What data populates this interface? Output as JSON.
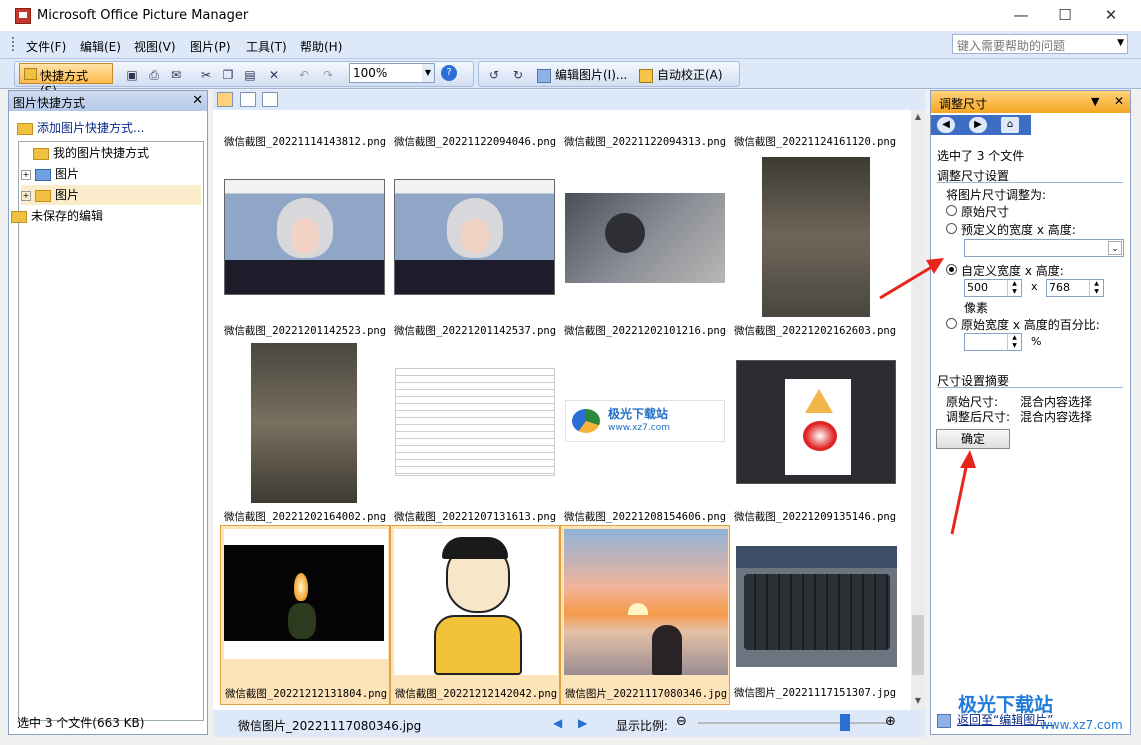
{
  "window": {
    "title": "Microsoft Office Picture Manager",
    "minimize": "—",
    "maximize": "☐",
    "close": "✕"
  },
  "menu": [
    "文件(F)",
    "编辑(E)",
    "视图(V)",
    "图片(P)",
    "工具(T)",
    "帮助(H)"
  ],
  "help_box": {
    "placeholder": "键入需要帮助的问题"
  },
  "toolbar": {
    "shortcut_label": "快捷方式(S)...",
    "zoom_value": "100%",
    "edit_pictures": "编辑图片(I)...",
    "auto_correct": "自动校正(A)"
  },
  "left_pane": {
    "title": "图片快捷方式",
    "add_shortcut": "添加图片快捷方式...",
    "tree": [
      {
        "label": "我的图片快捷方式",
        "level": 0
      },
      {
        "label": "图片",
        "level": 1
      },
      {
        "label": "图片",
        "level": 1,
        "selected": true
      },
      {
        "label": "未保存的编辑",
        "level": 0
      }
    ],
    "status": "选中 3 个文件(663 KB)"
  },
  "gallery": {
    "rows": [
      [
        "微信截图_20221114143812.png",
        "微信截图_20221122094046.png",
        "微信截图_20221122094313.png",
        "微信截图_20221124161120.png"
      ],
      [
        "微信截图_20221201142523.png",
        "微信截图_20221201142537.png",
        "微信截图_20221202101216.png",
        "微信截图_20221202162603.png"
      ],
      [
        "微信截图_20221202164002.png",
        "微信截图_20221207131613.png",
        "微信截图_20221208154606.png",
        "微信截图_20221209135146.png"
      ],
      [
        "微信截图_20221212131804.png",
        "微信截图_20221212142042.png",
        "微信图片_20221117080346.jpg",
        "微信图片_20221117151307.jpg"
      ]
    ],
    "selected": [
      "微信截图_20221212131804.png",
      "微信截图_20221212142042.png",
      "微信图片_20221117080346.jpg"
    ],
    "logo_text": "极光下载站",
    "logo_url": "www.xz7.com"
  },
  "status_bar": {
    "current_file": "微信图片_20221117080346.jpg",
    "zoom_label": "显示比例:"
  },
  "right_pane": {
    "title": "调整尺寸",
    "selected_count": "选中了 3 个文件",
    "section_settings": "调整尺寸设置",
    "resize_to": "将图片尺寸调整为:",
    "opt_original": "原始尺寸",
    "opt_predefined": "预定义的宽度 x 高度:",
    "opt_custom": "自定义宽度 x 高度:",
    "width_value": "500",
    "times": "x",
    "height_value": "768",
    "pixels": "像素",
    "opt_percent": "原始宽度 x 高度的百分比:",
    "percent_sign": "%",
    "section_summary": "尺寸设置摘要",
    "original_size_label": "原始尺寸:",
    "original_size_value": "混合内容选择",
    "new_size_label": "调整后尺寸:",
    "new_size_value": "混合内容选择",
    "ok_button": "确定",
    "back_link": "返回至“编辑图片”"
  },
  "watermark": {
    "brand": "极光下载站",
    "url": "www.xz7.com"
  }
}
